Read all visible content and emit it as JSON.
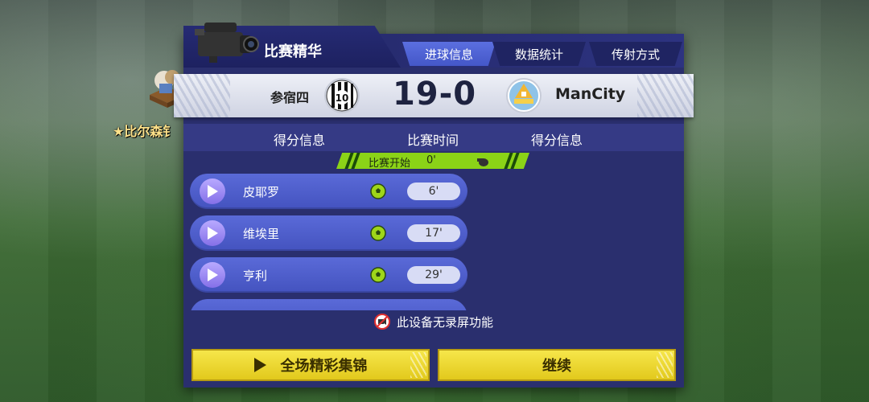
{
  "sidebar": {
    "league_label": "★比尔森钅"
  },
  "header": {
    "title": "比赛精华",
    "tabs": [
      {
        "label": "进球信息",
        "active": true
      },
      {
        "label": "数据统计",
        "active": false
      },
      {
        "label": "传射方式",
        "active": false
      }
    ]
  },
  "match": {
    "home_team": "参宿四",
    "home_crest_icon": "jersey-10-crest-icon",
    "away_team": "ManCity",
    "away_crest_icon": "boat-crest-icon",
    "score": "19-0"
  },
  "columns": {
    "left": "得分信息",
    "center": "比赛时间",
    "right": "得分信息"
  },
  "kickoff": {
    "label": "比赛开始",
    "time": "0'"
  },
  "goals": [
    {
      "player": "皮耶罗",
      "time": "6'"
    },
    {
      "player": "维埃里",
      "time": "17'"
    },
    {
      "player": "亨利",
      "time": "29'"
    }
  ],
  "notice": "此设备无录屏功能",
  "buttons": {
    "highlights": "全场精彩集锦",
    "continue": "继续"
  },
  "colors": {
    "panel": "#2a2f6e",
    "tab_active": "#5b6fe0",
    "button_yellow": "#f6e64a",
    "kickoff_green": "#8bd317"
  }
}
